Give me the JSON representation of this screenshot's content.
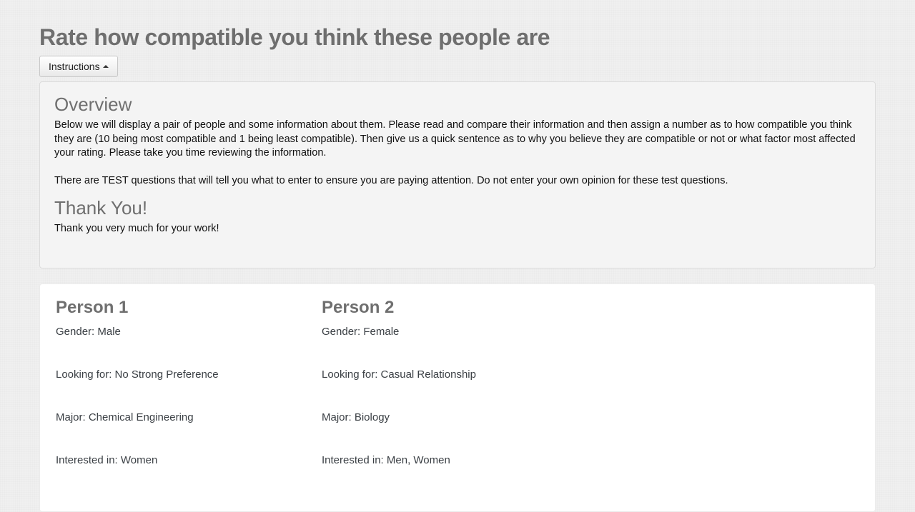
{
  "header": {
    "title": "Rate how compatible you think these people are"
  },
  "instructions": {
    "toggle_label": "Instructions",
    "overview_heading": "Overview",
    "overview_paragraph_1": "Below we will display a pair of people and some information about them. Please read and compare their information and then assign a number as to how compatible you think they are (10 being most compatible and 1 being least compatible). Then give us a quick sentence as to why you believe they are compatible or not or what factor most affected your rating. Please take you time reviewing the information.",
    "overview_paragraph_2": "There are TEST questions that will tell you what to enter to ensure you are paying attention. Do not enter your own opinion for these test questions.",
    "thanks_heading": "Thank You!",
    "thanks_text": "Thank you very much for your work!"
  },
  "persons": [
    {
      "heading": "Person 1",
      "gender": "Gender: Male",
      "looking_for": "Looking for: No Strong Preference",
      "major": "Major: Chemical Engineering",
      "interested_in": "Interested in: Women"
    },
    {
      "heading": "Person 2",
      "gender": "Gender: Female",
      "looking_for": "Looking for: Casual Relationship",
      "major": "Major: Biology",
      "interested_in": "Interested in: Men, Women"
    }
  ],
  "icons": {
    "instructions_caret": "caret-up-icon"
  },
  "colors": {
    "heading_gray": "#6f6f6f",
    "panel_background": "#f4f4f4",
    "card_background": "#ffffff",
    "page_background": "#f0f0f0"
  }
}
